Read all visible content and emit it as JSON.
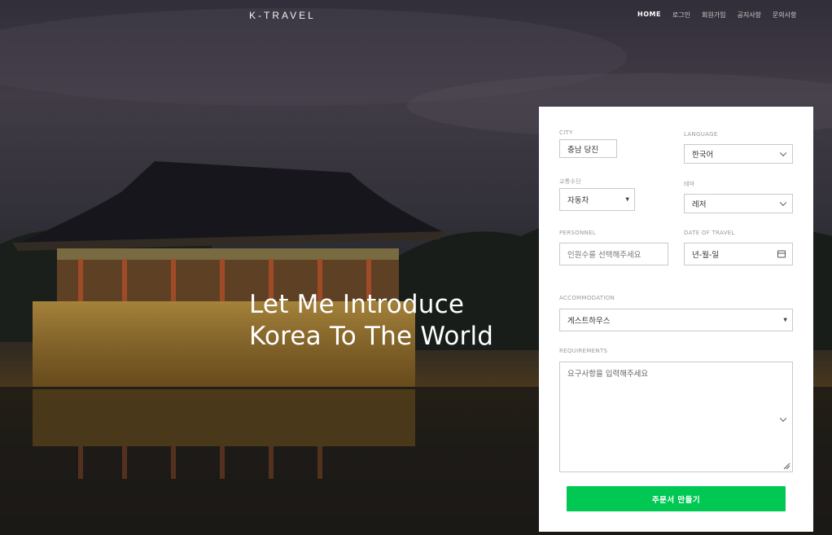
{
  "brand": "K-TRAVEL",
  "nav": [
    "HOME",
    "로그인",
    "회원가입",
    "공지사항",
    "문의사항"
  ],
  "hero": {
    "line1": "Let Me Introduce",
    "line2": "Korea To The World"
  },
  "form": {
    "city": {
      "label": "CITY",
      "value": "충남 당진"
    },
    "language": {
      "label": "LANGUAGE",
      "value": "한국어"
    },
    "transport": {
      "label": "교통수단",
      "value": "자동차"
    },
    "theme": {
      "label": "테마",
      "value": "레저"
    },
    "personnel": {
      "label": "PERSONNEL",
      "placeholder": "인원수를 선택해주세요"
    },
    "date": {
      "label": "DATE OF TRAVEL",
      "value": "년-월-일"
    },
    "accommodation": {
      "label": "ACCOMMODATION",
      "value": "게스트하우스"
    },
    "requirements": {
      "label": "REQUIREMENTS",
      "placeholder": "요구사항을 입력해주세요"
    },
    "submit": "주문서 만들기"
  },
  "colors": {
    "submit_bg": "#00c853",
    "panel_bg": "#ffffff"
  }
}
